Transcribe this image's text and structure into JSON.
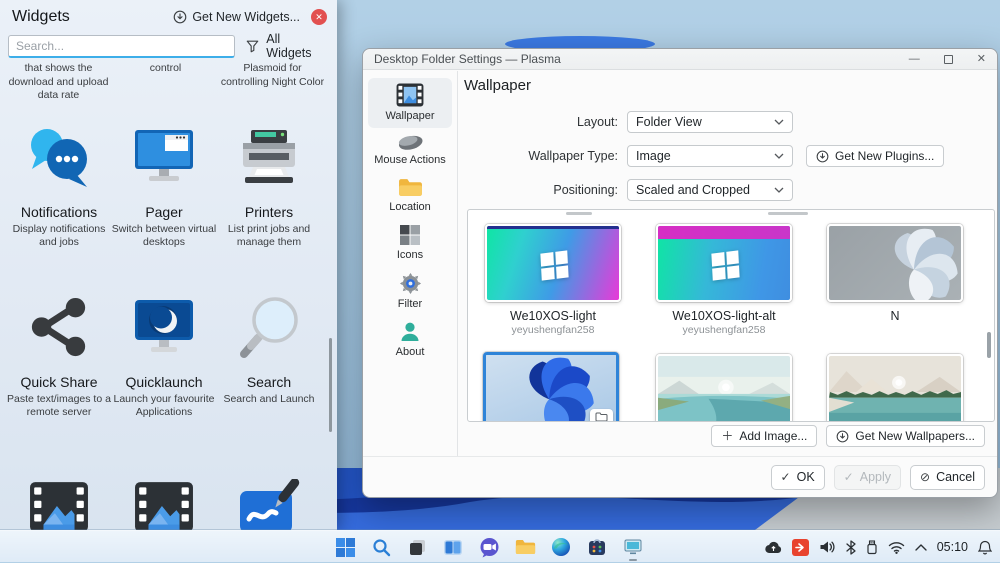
{
  "accent": {
    "highlight": "#3daee9",
    "selection_border": "#2f84d8",
    "close_red": "#e25050"
  },
  "widgets_panel": {
    "title": "Widgets",
    "get_new_widgets": "Get New Widgets...",
    "search_placeholder": "Search...",
    "all_widgets": "All Widgets",
    "partial_descriptions": [
      "that shows the download and upload data rate",
      "control",
      "Plasmoid for controlling Night Color"
    ],
    "items": [
      {
        "name": "Notifications",
        "description": "Display notifications and jobs",
        "icon": "chat-bubbles"
      },
      {
        "name": "Pager",
        "description": "Switch between virtual desktops",
        "icon": "virtual-desktop-monitor"
      },
      {
        "name": "Printers",
        "description": "List print jobs and manage them",
        "icon": "printer"
      },
      {
        "name": "Quick Share",
        "description": "Paste text/images to a remote server",
        "icon": "share-nodes"
      },
      {
        "name": "Quicklaunch",
        "description": "Launch your favourite Applications",
        "icon": "monitor-moon"
      },
      {
        "name": "Search",
        "description": "Search and Launch",
        "icon": "magnifier"
      }
    ],
    "partial_bottom_icons": [
      "media-frame",
      "media-frame",
      "whiteboard-pen"
    ]
  },
  "dialog": {
    "title": "Desktop Folder Settings — Plasma",
    "sidebar": [
      {
        "label": "Wallpaper",
        "icon": "filmstrip"
      },
      {
        "label": "Mouse Actions",
        "icon": "mouse"
      },
      {
        "label": "Location",
        "icon": "folder"
      },
      {
        "label": "Icons",
        "icon": "icon-grid"
      },
      {
        "label": "Filter",
        "icon": "gear"
      },
      {
        "label": "About",
        "icon": "person"
      }
    ],
    "heading": "Wallpaper",
    "form": {
      "layout_label": "Layout:",
      "layout_value": "Folder View",
      "wallpaper_type_label": "Wallpaper Type:",
      "wallpaper_type_value": "Image",
      "get_new_plugins": "Get New Plugins...",
      "positioning_label": "Positioning:",
      "positioning_value": "Scaled and Cropped"
    },
    "wallpapers": [
      {
        "name": "We10XOS-light",
        "author": "yeyushengfan258"
      },
      {
        "name": "We10XOS-light-alt",
        "author": "yeyushengfan258"
      },
      {
        "name": "N",
        "author": ""
      }
    ],
    "actions": {
      "add_image": "Add Image...",
      "get_new_wallpapers": "Get New Wallpapers..."
    },
    "footer": {
      "ok": "OK",
      "apply": "Apply",
      "cancel": "Cancel"
    }
  },
  "taskbar": {
    "clock": "05:10"
  }
}
